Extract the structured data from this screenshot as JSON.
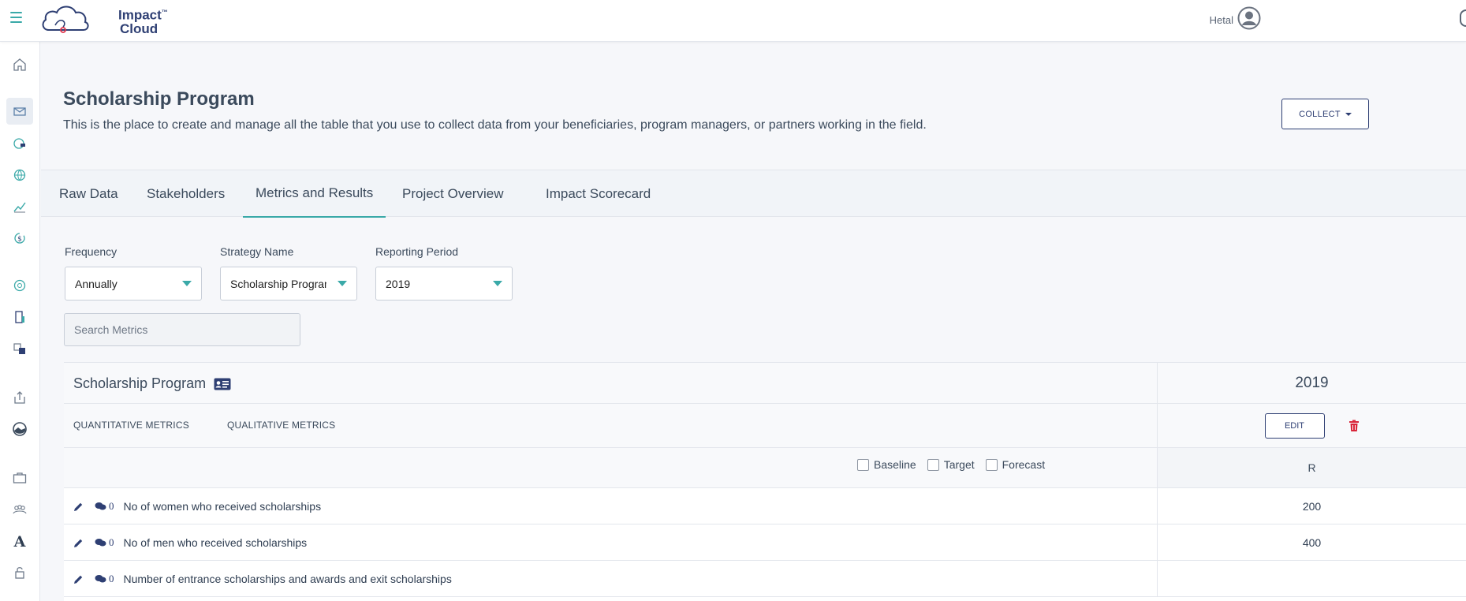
{
  "topbar": {
    "logo_line1": "Impact",
    "logo_tm": "™",
    "logo_line2": "Cloud",
    "user_name": "Hetal"
  },
  "sidebar": {
    "icons": [
      "home-icon",
      "inbox-icon",
      "globe-money-icon",
      "globe-icon",
      "trend-chart-icon",
      "dollar-cycle-icon",
      "network-globe-icon",
      "building-icon",
      "translate-icon",
      "upload-icon",
      "landscape-icon",
      "briefcase-icon",
      "team-icon",
      "font-icon",
      "lock-icon"
    ],
    "active_index": 1
  },
  "header": {
    "title": "Scholarship Program",
    "subtitle": "This is the place to create and manage all the table that you use to collect data from your beneficiaries, program managers, or partners working in the field.",
    "collect_label": "COLLECT"
  },
  "tabs": [
    {
      "label": "Raw Data"
    },
    {
      "label": "Stakeholders"
    },
    {
      "label": "Metrics and Results"
    },
    {
      "label": "Project Overview"
    },
    {
      "label": "Impact Scorecard"
    }
  ],
  "active_tab": 2,
  "filters": {
    "frequency": {
      "label": "Frequency",
      "value": "Annually"
    },
    "strategy": {
      "label": "Strategy Name",
      "value": "Scholarship Program"
    },
    "period": {
      "label": "Reporting Period",
      "value": "2019"
    }
  },
  "search": {
    "placeholder": "Search Metrics"
  },
  "table": {
    "program_title": "Scholarship Program",
    "year": "2019",
    "metric_tabs": [
      "QUANTITATIVE METRICS",
      "QUALITATIVE METRICS"
    ],
    "edit_label": "EDIT",
    "checkboxes": [
      "Baseline",
      "Target",
      "Forecast"
    ],
    "column_header": "R",
    "rows": [
      {
        "comments": "0",
        "name": "No of women who received scholarships",
        "value": "200"
      },
      {
        "comments": "0",
        "name": "No of men who received scholarships",
        "value": "400"
      },
      {
        "comments": "0",
        "name": "Number of entrance scholarships and awards and exit scholarships",
        "value": ""
      }
    ]
  },
  "colors": {
    "accent": "#3aa9a8",
    "brand": "#2e3f73",
    "danger": "#d9263a"
  }
}
